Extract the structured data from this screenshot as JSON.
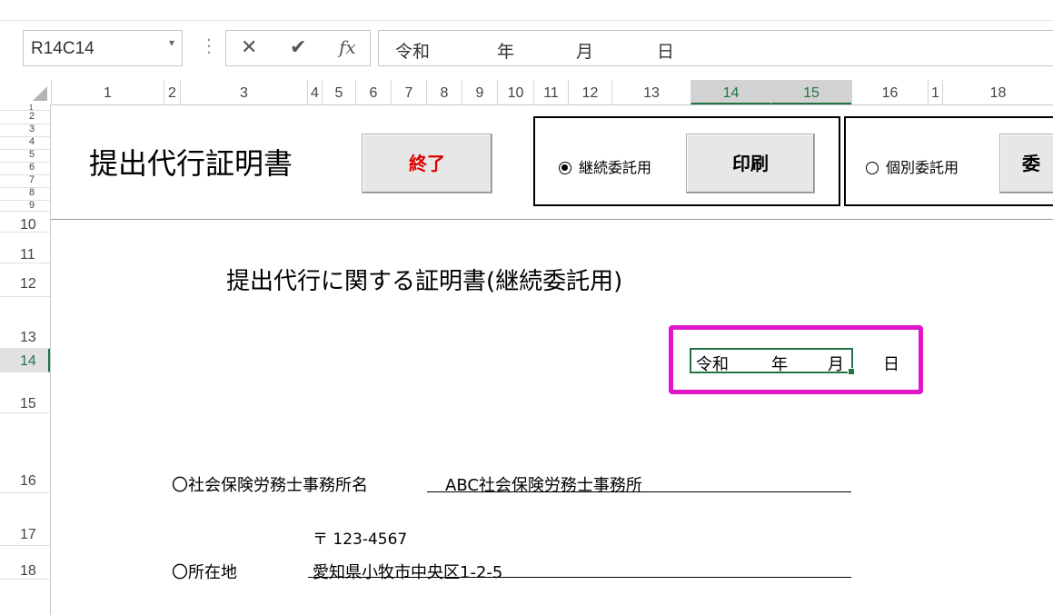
{
  "formula_bar": {
    "name_box": "R14C14",
    "cancel_icon": "✕",
    "enter_icon": "✔",
    "fx_icon": "fx",
    "content": {
      "era": "令和",
      "year": "年",
      "month": "月",
      "day": "日"
    }
  },
  "columns": [
    "1",
    "2",
    "3",
    "4",
    "5",
    "6",
    "7",
    "8",
    "9",
    "10",
    "11",
    "12",
    "13",
    "14",
    "15",
    "16",
    "1",
    "18"
  ],
  "rows": {
    "r1": "1",
    "r2": "2",
    "r3": "3",
    "r4": "4",
    "r5": "5",
    "r6": "6",
    "r7": "7",
    "r8": "8",
    "r9": "9",
    "r10": "10",
    "r11": "11",
    "r12": "12",
    "r13": "13",
    "r14": "14",
    "r15": "15",
    "r16": "16",
    "r17": "17",
    "r18": "18"
  },
  "header": {
    "title": "提出代行証明書",
    "quit_label": "終了",
    "radio_continuous": "継続委託用",
    "print_label": "印刷",
    "radio_individual": "個別委託用",
    "other_label": "委"
  },
  "document": {
    "title": "提出代行に関する証明書(継続委託用)",
    "date": {
      "era": "令和",
      "year": "年",
      "month": "月",
      "day": "日"
    },
    "office_label": "〇社会保険労務士事務所名",
    "office_value": "ABC社会保険労務士事務所",
    "postal": "〒 123-4567",
    "address_label": "〇所在地",
    "address_value": "愛知県小牧市中央区1-2-5"
  },
  "colors": {
    "accent": "#217346",
    "highlight": "#e014c8",
    "quit_text": "#e00000"
  }
}
